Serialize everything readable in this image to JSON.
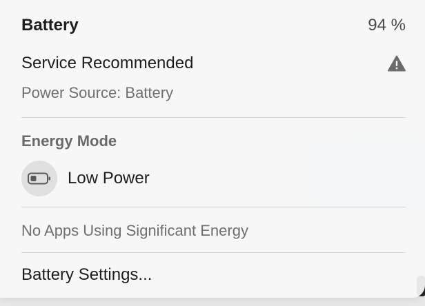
{
  "battery": {
    "title": "Battery",
    "percent": "94 %"
  },
  "service": {
    "label": "Service Recommended",
    "icon": "warning-triangle-icon"
  },
  "power_source": "Power Source: Battery",
  "energy_mode": {
    "heading": "Energy Mode",
    "low_power_label": "Low Power",
    "icon": "battery-icon"
  },
  "apps_status": "No Apps Using Significant Energy",
  "settings_label": "Battery Settings..."
}
